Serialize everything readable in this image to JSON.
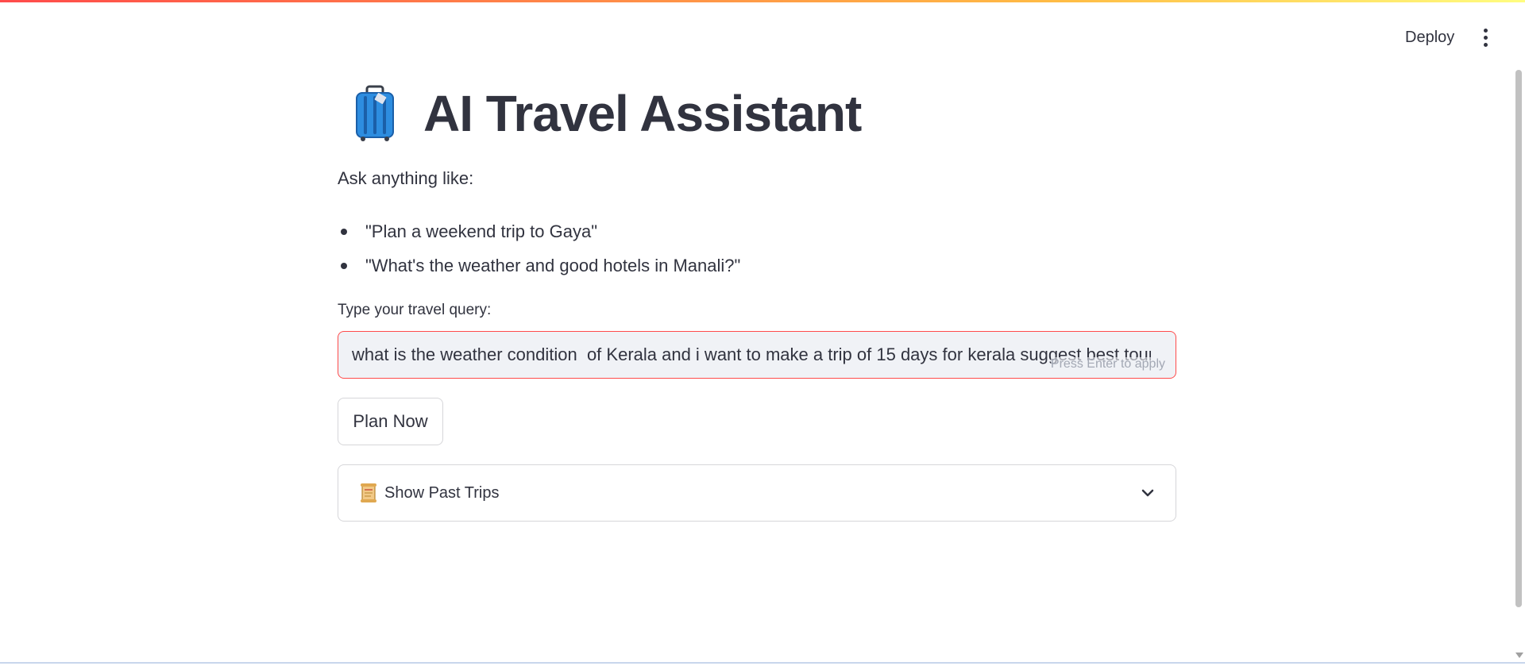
{
  "header": {
    "deploy_label": "Deploy",
    "menu_icon": "kebab-menu-icon"
  },
  "main": {
    "title_icon": "luggage-icon",
    "title": "AI Travel Assistant",
    "intro": "Ask anything like:",
    "examples": [
      "\"Plan a weekend trip to Gaya\"",
      "\"What's the weather and good hotels in Manali?\""
    ],
    "query": {
      "label": "Type your travel query:",
      "value": "what is the weather condition  of Kerala and i want to make a trip of 15 days for kerala suggest best tourist places",
      "hint": "Press Enter to apply"
    },
    "plan_button_label": "Plan Now",
    "expander": {
      "icon": "scroll-icon",
      "label": "Show Past Trips"
    }
  },
  "colors": {
    "accent": "#ff4b4b",
    "text": "#31333f",
    "input_bg": "#f0f2f6"
  }
}
